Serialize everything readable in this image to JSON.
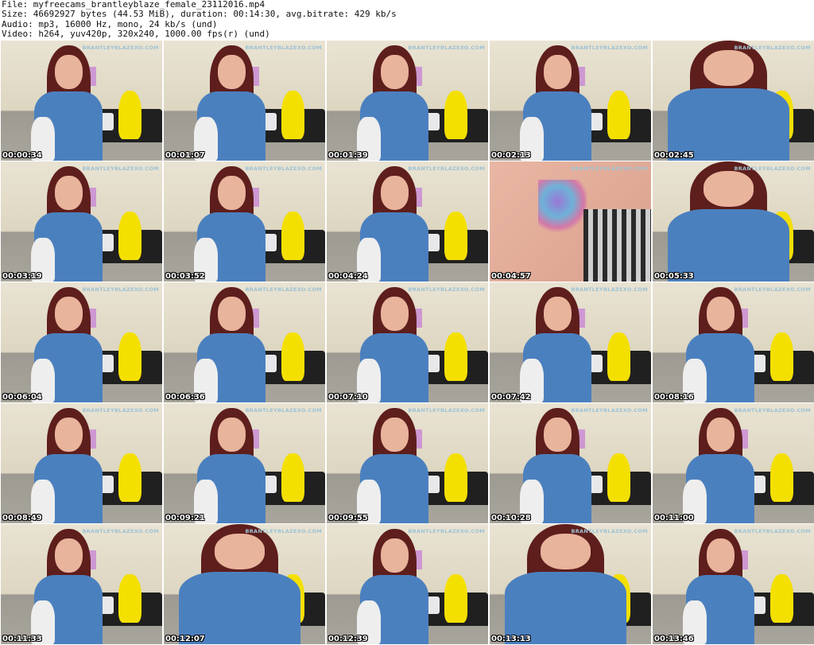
{
  "header": {
    "file": "File: myfreecams_brantleyblaze_female_23112016.mp4",
    "size": "Size: 46692927 bytes (44.53 MiB), duration: 00:14:30, avg.bitrate: 429 kb/s",
    "audio": "Audio: mp3, 16000 Hz, mono, 24 kb/s (und)",
    "video": "Video: h264, yuv420p, 320x240, 1000.00 fps(r) (und)"
  },
  "watermark": "BRANTLEYBLAZEXO.COM",
  "thumbnails": [
    {
      "timestamp": "00:00:34",
      "kind": "seated"
    },
    {
      "timestamp": "00:01:07",
      "kind": "seated"
    },
    {
      "timestamp": "00:01:39",
      "kind": "seated"
    },
    {
      "timestamp": "00:02:13",
      "kind": "seated"
    },
    {
      "timestamp": "00:02:45",
      "kind": "closeup"
    },
    {
      "timestamp": "00:03:19",
      "kind": "seated"
    },
    {
      "timestamp": "00:03:52",
      "kind": "seated"
    },
    {
      "timestamp": "00:04:24",
      "kind": "seated"
    },
    {
      "timestamp": "00:04:57",
      "kind": "tattoo"
    },
    {
      "timestamp": "00:05:33",
      "kind": "closeup"
    },
    {
      "timestamp": "00:06:04",
      "kind": "seated"
    },
    {
      "timestamp": "00:06:36",
      "kind": "seated"
    },
    {
      "timestamp": "00:07:10",
      "kind": "seated"
    },
    {
      "timestamp": "00:07:42",
      "kind": "seated"
    },
    {
      "timestamp": "00:08:16",
      "kind": "seated"
    },
    {
      "timestamp": "00:08:49",
      "kind": "seated"
    },
    {
      "timestamp": "00:09:21",
      "kind": "seated"
    },
    {
      "timestamp": "00:09:55",
      "kind": "seated"
    },
    {
      "timestamp": "00:10:28",
      "kind": "seated"
    },
    {
      "timestamp": "00:11:00",
      "kind": "seated"
    },
    {
      "timestamp": "00:11:33",
      "kind": "seated"
    },
    {
      "timestamp": "00:12:07",
      "kind": "closeup"
    },
    {
      "timestamp": "00:12:39",
      "kind": "seated"
    },
    {
      "timestamp": "00:13:13",
      "kind": "closeup"
    },
    {
      "timestamp": "00:13:46",
      "kind": "seated"
    }
  ]
}
